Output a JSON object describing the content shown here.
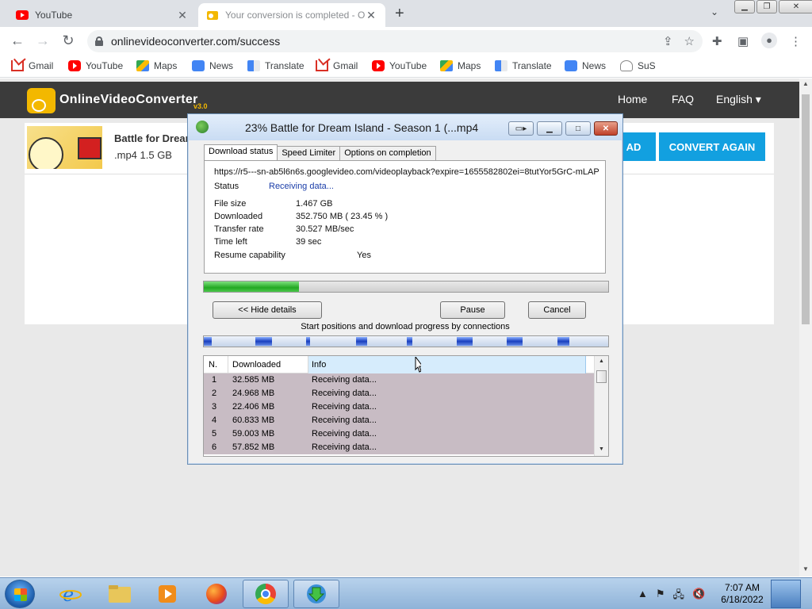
{
  "browser": {
    "tabs": [
      {
        "title": "YouTube",
        "favicon": "youtube-icon",
        "active": false
      },
      {
        "title": "Your conversion is completed - O",
        "favicon": "ovc-icon",
        "active": true
      }
    ],
    "url": "onlinevideoconverter.com/success",
    "bookmarks": [
      {
        "label": "Gmail",
        "icon": "gmail-icon"
      },
      {
        "label": "YouTube",
        "icon": "youtube-icon"
      },
      {
        "label": "Maps",
        "icon": "maps-icon"
      },
      {
        "label": "News",
        "icon": "news-icon"
      },
      {
        "label": "Translate",
        "icon": "translate-icon"
      },
      {
        "label": "Gmail",
        "icon": "gmail-icon"
      },
      {
        "label": "YouTube",
        "icon": "youtube-icon"
      },
      {
        "label": "Maps",
        "icon": "maps-icon"
      },
      {
        "label": "Translate",
        "icon": "translate-icon"
      },
      {
        "label": "News",
        "icon": "news-icon"
      },
      {
        "label": "SuS",
        "icon": "sus-icon"
      }
    ]
  },
  "site": {
    "logo": "OnlineVideoConverter",
    "version": "v3.0",
    "nav": [
      "Home",
      "FAQ",
      "English ▾"
    ],
    "video_title": "Battle for Dream",
    "video_meta": ".mp4 1.5 GB",
    "download_btn_partial": "AD",
    "convert_again": "CONVERT AGAIN",
    "accent": "#12a0e0"
  },
  "dialog": {
    "title": "23% Battle for Dream Island - Season 1 (...mp4",
    "tabs": [
      "Download status",
      "Speed Limiter",
      "Options on completion"
    ],
    "url": "https://r5---sn-ab5l6n6s.googlevideo.com/videoplayback?expire=1655582802ei=8tutYor5GrC-mLAP",
    "status_label": "Status",
    "status_value": "Receiving data...",
    "file_size_label": "File size",
    "file_size": "1.467  GB",
    "downloaded_label": "Downloaded",
    "downloaded": "352.750  MB  ( 23.45 % )",
    "transfer_label": "Transfer rate",
    "transfer": "30.527  MB/sec",
    "time_left_label": "Time left",
    "time_left": "39 sec",
    "resume_label": "Resume capability",
    "resume": "Yes",
    "progress_fraction": 0.2345,
    "hide_details": "<< Hide details",
    "pause": "Pause",
    "cancel": "Cancel",
    "connections_label": "Start positions and download progress by connections",
    "columns": [
      "N.",
      "Downloaded",
      "Info"
    ],
    "connections": [
      {
        "n": "1",
        "downloaded": "32.585  MB",
        "info": "Receiving data..."
      },
      {
        "n": "2",
        "downloaded": "24.968  MB",
        "info": "Receiving data..."
      },
      {
        "n": "3",
        "downloaded": "22.406  MB",
        "info": "Receiving data..."
      },
      {
        "n": "4",
        "downloaded": "60.833  MB",
        "info": "Receiving data..."
      },
      {
        "n": "5",
        "downloaded": "59.003  MB",
        "info": "Receiving data..."
      },
      {
        "n": "6",
        "downloaded": "57.852  MB",
        "info": "Receiving data..."
      }
    ]
  },
  "taskbar": {
    "apps": [
      "internet-explorer-icon",
      "file-explorer-icon",
      "media-player-icon",
      "firefox-icon",
      "chrome-icon",
      "idm-icon"
    ],
    "time": "7:07 AM",
    "date": "6/18/2022"
  }
}
